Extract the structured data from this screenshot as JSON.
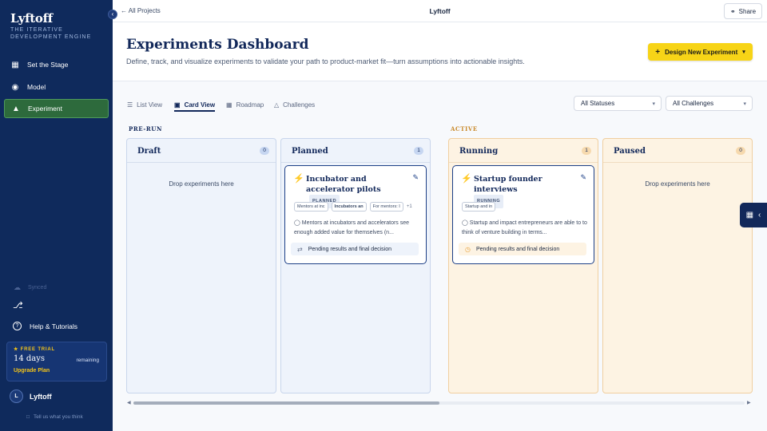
{
  "sidebar": {
    "brand": "Lyftoff",
    "tagline": "THE ITERATIVE DEVELOPMENT ENGINE",
    "items": [
      {
        "label": "Set the Stage",
        "icon": "stage-icon"
      },
      {
        "label": "Model",
        "icon": "model-icon"
      },
      {
        "label": "Experiment",
        "icon": "flask-icon",
        "active": true
      }
    ],
    "synced": "Synced",
    "help": "Help & Tutorials",
    "trial": {
      "label": "FREE TRIAL",
      "days": "14 days",
      "remaining": "remaining",
      "upgrade": "Upgrade Plan"
    },
    "user": {
      "initial": "L",
      "name": "Lyftoff"
    },
    "feedback": "Tell us what you think"
  },
  "topbar": {
    "back": "All Projects",
    "title": "Lyftoff",
    "share": "Share"
  },
  "header": {
    "title": "Experiments Dashboard",
    "subtitle": "Define, track, and visualize experiments to validate your path to product-market fit—turn assumptions into actionable insights.",
    "design_button": "Design New Experiment"
  },
  "toolbar": {
    "tabs": [
      "List View",
      "Card View",
      "Roadmap",
      "Challenges"
    ],
    "active_tab": "Card View",
    "status_filter": "All Statuses",
    "challenge_filter": "All Challenges"
  },
  "groups": {
    "prerun": "PRE-RUN",
    "active": "ACTIVE"
  },
  "columns": {
    "draft": {
      "title": "Draft",
      "count": "0",
      "empty": "Drop experiments here"
    },
    "planned": {
      "title": "Planned",
      "count": "1"
    },
    "running": {
      "title": "Running",
      "count": "1"
    },
    "paused": {
      "title": "Paused",
      "count": "0",
      "empty": "Drop experiments here"
    }
  },
  "cards": {
    "planned": {
      "title": "Incubator and accelerator pilots",
      "status": "PLANNED",
      "chips": [
        "Mentors at inc",
        "Incubators an",
        "For mentors: I"
      ],
      "more": "+1",
      "description": "Mentors at incubators and accelerators see enough added value for themselves (n...",
      "result": "Pending results and final decision"
    },
    "running": {
      "title": "Startup founder interviews",
      "status": "RUNNING",
      "chips": [
        "Startup and in"
      ],
      "description": "Startup and impact entrepreneurs are able to to think of venture building in terms...",
      "result": "Pending results and final decision"
    }
  },
  "colors": {
    "sidebar": "#0f2a5c",
    "accent": "#f7d417",
    "active_nav": "#2d6a3c",
    "card_border": "#1b3e86"
  }
}
